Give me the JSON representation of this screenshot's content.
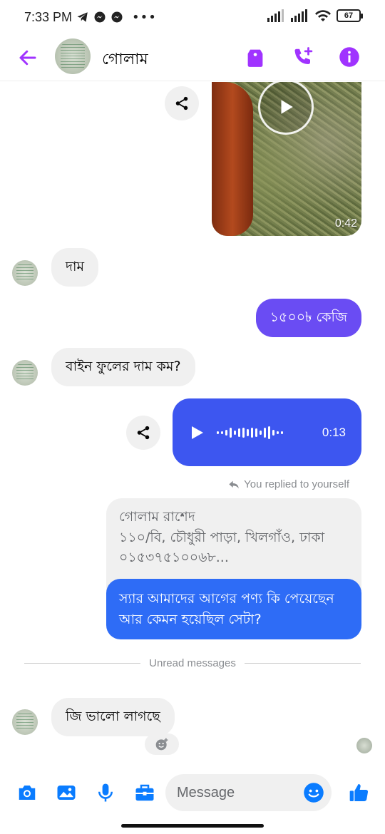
{
  "status_bar": {
    "time": "7:33 PM",
    "battery": "67"
  },
  "header": {
    "contact_name": "গোলাম",
    "accent": "#a033ff"
  },
  "messages": {
    "video": {
      "duration": "0:42"
    },
    "incoming_1": "দাম",
    "outgoing_1": "১৫০০৳ কেজি",
    "incoming_2": "বাইন ফুলের দাম কম?",
    "audio": {
      "duration": "0:13"
    },
    "replied_label": "You replied to yourself",
    "quoted_text": "গোলাম রাশেদ\n১১০/বি, চৌধুরী পাড়া, খিলগাঁও, ঢাকা\n০১৫৩৭৫১০০৬৮...",
    "reply_text": "স্যার আমাদের আগের পণ্য কি পেয়েছেন আর কেমন হয়েছিল সেটা?",
    "unread_divider": "Unread messages",
    "incoming_3": "জি ভালো লাগছে"
  },
  "composer": {
    "placeholder": "Message"
  },
  "colors": {
    "outgoing_purple": "#6a4cf3",
    "audio_blue": "#3d56f0",
    "reply_blue": "#2e6cf6",
    "icon_blue": "#0a7cff"
  }
}
